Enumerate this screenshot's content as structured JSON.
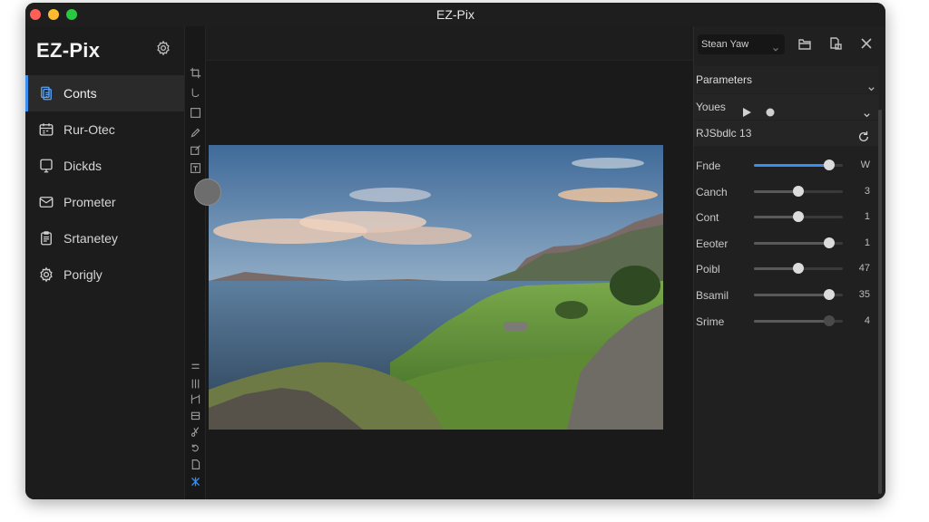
{
  "window": {
    "title": "EZ-Pix"
  },
  "app": {
    "name": "EZ-Pix"
  },
  "sidebar": {
    "items": [
      {
        "label": "Conts",
        "icon": "document-icon",
        "active": true
      },
      {
        "label": "Rur-Otec",
        "icon": "calendar-icon",
        "active": false
      },
      {
        "label": "Dickds",
        "icon": "monitor-icon",
        "active": false
      },
      {
        "label": "Prometer",
        "icon": "mail-icon",
        "active": false
      },
      {
        "label": "Srtanetey",
        "icon": "clipboard-icon",
        "active": false
      },
      {
        "label": "Porigly",
        "icon": "gear-icon",
        "active": false
      }
    ]
  },
  "right_panel": {
    "view_select": "Stean Yaw",
    "parameters_title": "Parameters",
    "preset_label": "Youes",
    "profile_label": "RJSbdlc 13",
    "params": [
      {
        "label": "Fnde",
        "value": "W",
        "level": 0.85,
        "active": true
      },
      {
        "label": "Canch",
        "value": "3",
        "level": 0.5,
        "active": false
      },
      {
        "label": "Cont",
        "value": "1",
        "level": 0.5,
        "active": false
      },
      {
        "label": "Eeoter",
        "value": "1",
        "level": 0.85,
        "active": false
      },
      {
        "label": "Poibl",
        "value": "47",
        "level": 0.5,
        "active": false
      },
      {
        "label": "Bsamil",
        "value": "35",
        "level": 0.85,
        "active": false
      },
      {
        "label": "Srime",
        "value": "4",
        "level": 0.85,
        "active": false,
        "dim": true
      }
    ]
  },
  "colors": {
    "accent": "#3b8df0",
    "window_bg": "#1b1b1b",
    "panel_bg": "#202020"
  }
}
